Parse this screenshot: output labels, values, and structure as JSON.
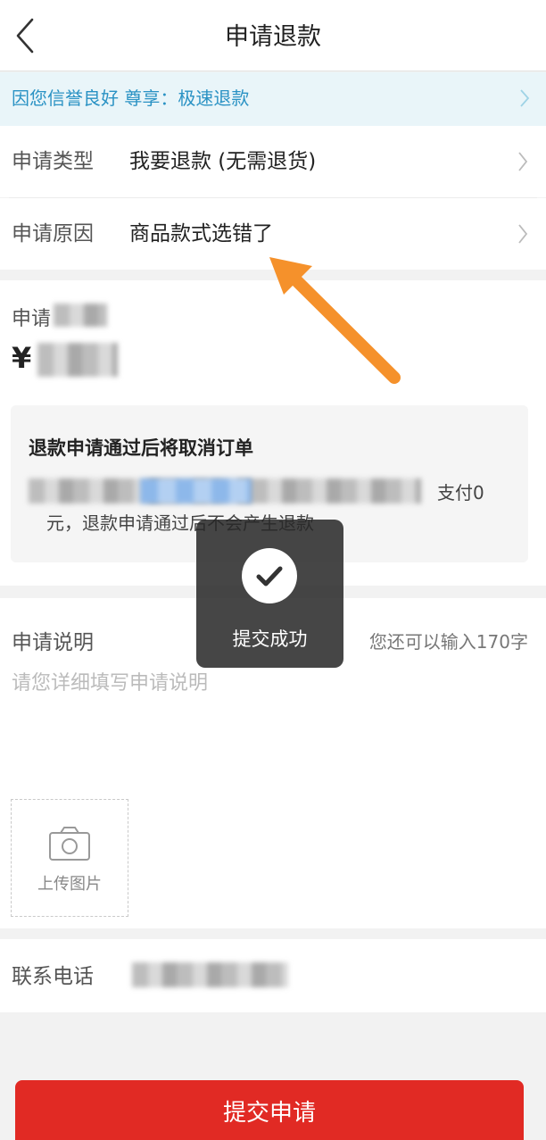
{
  "nav": {
    "title": "申请退款",
    "back_icon": "back-chevron-icon"
  },
  "notice": {
    "text": "因您信誉良好 尊享：极速退款",
    "color": "#2a92c4"
  },
  "form": {
    "type_label": "申请类型",
    "type_value": "我要退款 (无需退货)",
    "reason_label": "申请原因",
    "reason_value": "商品款式选错了",
    "amount_label": "申请",
    "amount_currency": "¥",
    "note_title": "退款申请通过后将取消订单",
    "note_tail": "支付0",
    "note_text": "元，退款申请通过后不会产生退款",
    "desc_label": "申请说明",
    "desc_counter": "您还可以输入170字",
    "desc_placeholder": "请您详细填写申请说明",
    "upload_label": "上传图片",
    "phone_label": "联系电话"
  },
  "toast": {
    "text": "提交成功",
    "icon": "check-icon"
  },
  "submit": {
    "label": "提交申请",
    "color": "#e12a24"
  },
  "annotation": {
    "arrow_color": "#f5912b"
  }
}
